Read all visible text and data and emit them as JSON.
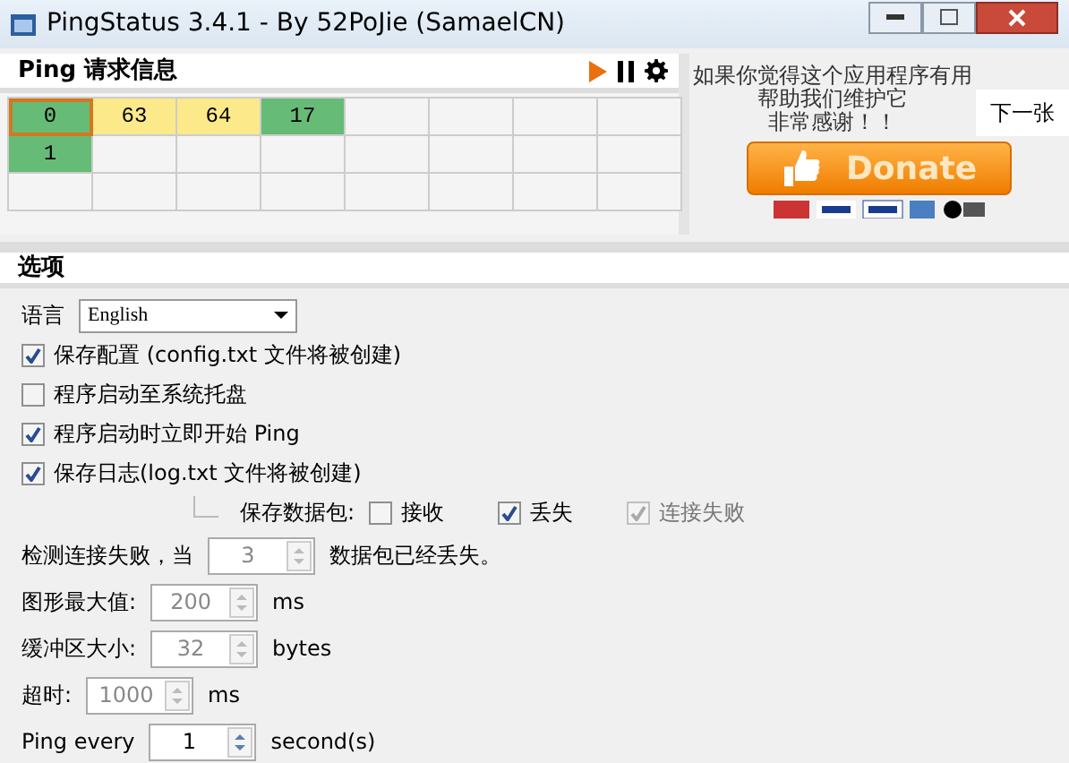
{
  "window": {
    "title": "PingStatus 3.4.1 - By 52PoJie (SamaelCN)"
  },
  "ping_panel": {
    "title": "Ping 请求信息",
    "rows": [
      [
        {
          "value": "0",
          "color": "#66bb77",
          "selected": true
        },
        {
          "value": "63",
          "color": "#fce98a",
          "selected": false
        },
        {
          "value": "64",
          "color": "#fce98a",
          "selected": false
        },
        {
          "value": "17",
          "color": "#66bb77",
          "selected": false
        }
      ],
      [
        {
          "value": "1",
          "color": "#66bb77",
          "selected": false
        }
      ]
    ]
  },
  "donate_panel": {
    "message_lines": [
      "如果你觉得这个应用程序有用",
      "帮助我们维护它",
      "非常感谢！！"
    ],
    "next_button": "下一张",
    "donate_button": "Donate"
  },
  "options": {
    "title": "选项",
    "language_label": "语言",
    "language_value": "English",
    "checkboxes": [
      {
        "label": "保存配置 (config.txt 文件将被创建)",
        "checked": true
      },
      {
        "label": "程序启动至系统托盘",
        "checked": false
      },
      {
        "label": "程序启动时立即开始 Ping",
        "checked": true
      },
      {
        "label": "保存日志(log.txt 文件将被创建)",
        "checked": true
      }
    ],
    "save_packets": {
      "label": "保存数据包:",
      "options": [
        {
          "label": "接收",
          "checked": false,
          "disabled": false
        },
        {
          "label": "丢失",
          "checked": true,
          "disabled": false
        },
        {
          "label": "连接失败",
          "checked": true,
          "disabled": true
        }
      ]
    },
    "spinners": [
      {
        "label": "检测连接失败，当",
        "value": "3",
        "unit": "数据包已经丢失。",
        "disabled": true
      },
      {
        "label": "图形最大值:",
        "value": "200",
        "unit": "ms",
        "disabled": true
      },
      {
        "label": "缓冲区大小:",
        "value": "32",
        "unit": "bytes",
        "disabled": true
      },
      {
        "label": "超时:",
        "value": "1000",
        "unit": "ms",
        "disabled": true
      },
      {
        "label": "Ping every",
        "value": "1",
        "unit": "second(s)",
        "disabled": false
      }
    ]
  }
}
